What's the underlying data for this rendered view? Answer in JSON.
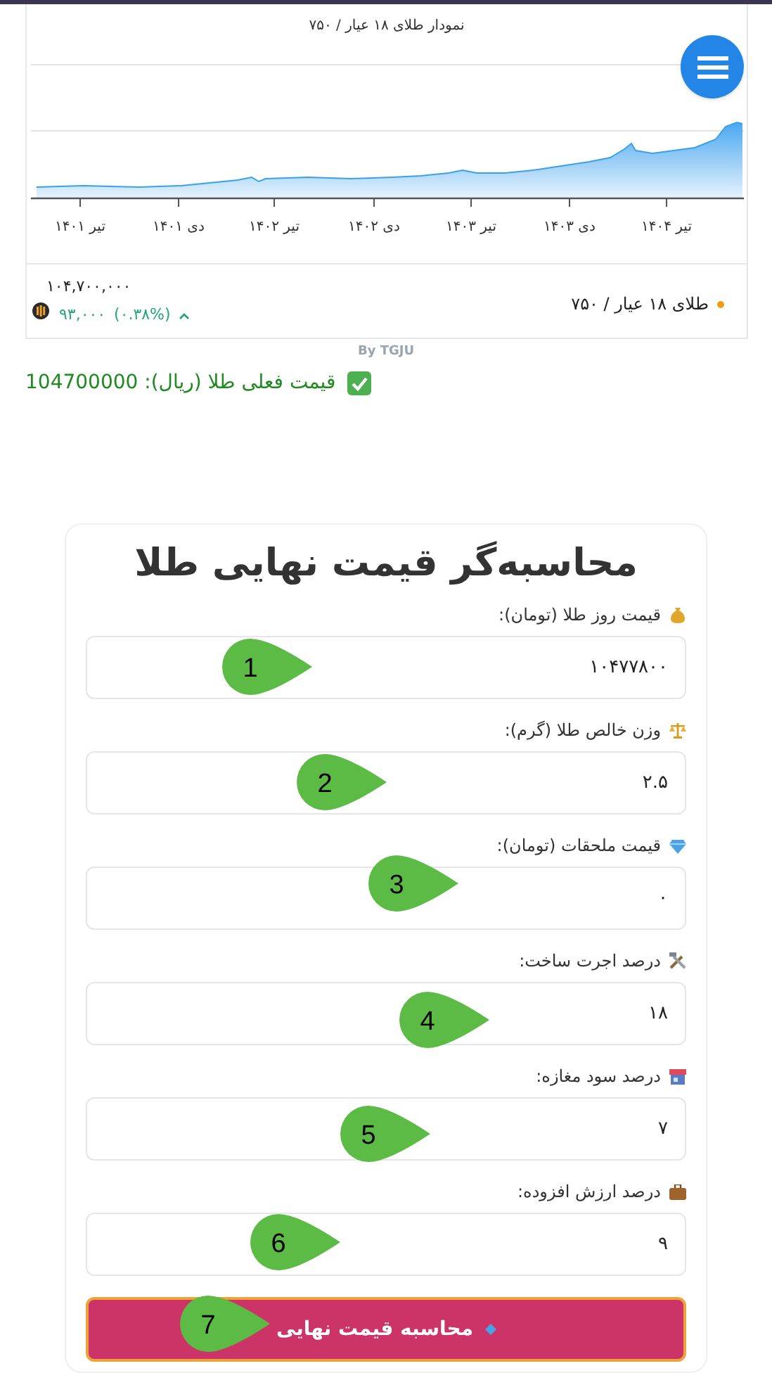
{
  "chart_card": {
    "title": "نمودار طلای ۱۸ عیار / ۷۵۰",
    "x_labels": [
      "تیر ۱۴۰۴",
      "دی ۱۴۰۳",
      "تیر ۱۴۰۳",
      "دی ۱۴۰۲",
      "تیر ۱۴۰۲",
      "دی ۱۴۰۱",
      "تیر ۱۴۰۱"
    ],
    "instrument": "طلای ۱۸ عیار / ۷۵۰",
    "price": "۱۰۴,۷۰۰,۰۰۰",
    "change": "۹۳,۰۰۰",
    "change_percent": "(۰.۳۸%)",
    "credit": "By TGJU"
  },
  "current_price": {
    "label": "قیمت فعلی طلا (ریال): 104700000"
  },
  "calculator": {
    "title": "محاسبه‌گر قیمت نهایی طلا",
    "fields": [
      {
        "kind": "money",
        "label": "قیمت روز طلا (تومان):",
        "value": "۱۰۴۷۷۸۰۰",
        "marker": "1"
      },
      {
        "kind": "scale",
        "label": "وزن خالص طلا (گرم):",
        "value": "۲.۵",
        "marker": "2"
      },
      {
        "kind": "gem",
        "label": "قیمت ملحقات (تومان):",
        "value": "۰",
        "marker": "3"
      },
      {
        "kind": "tools",
        "label": "درصد اجرت ساخت:",
        "value": "۱۸",
        "marker": "4"
      },
      {
        "kind": "shop",
        "label": "درصد سود مغازه:",
        "value": "۷",
        "marker": "5"
      },
      {
        "kind": "briefcase",
        "label": "درصد ارزش افزوده:",
        "value": "۹",
        "marker": "6"
      }
    ],
    "button": {
      "label": "محاسبه قیمت نهایی",
      "marker": "7"
    }
  }
}
